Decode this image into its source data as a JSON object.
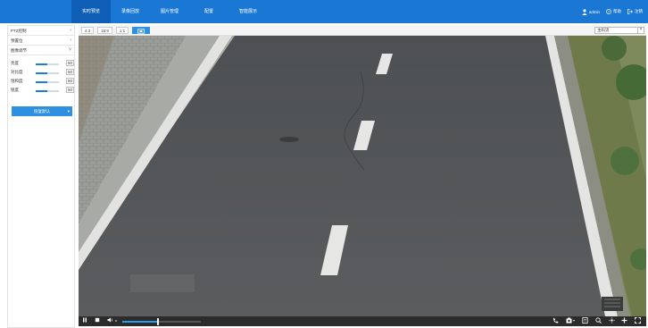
{
  "nav": {
    "items": [
      {
        "label": "实时预览",
        "active": true
      },
      {
        "label": "录像回放",
        "active": false
      },
      {
        "label": "图片管理",
        "active": false
      },
      {
        "label": "配置",
        "active": false
      },
      {
        "label": "智能展示",
        "active": false
      }
    ]
  },
  "header": {
    "user": "admin",
    "help": "帮助",
    "logout": "注销"
  },
  "sidebar": {
    "ptz": "PTZ控制",
    "preset": "预置位",
    "image_adjust": "图像调节",
    "adjustments": [
      {
        "label": "亮度",
        "value": "50",
        "level": 0.5
      },
      {
        "label": "对比度",
        "value": "50",
        "level": 0.5
      },
      {
        "label": "饱和度",
        "value": "50",
        "level": 0.5
      },
      {
        "label": "锐度",
        "value": "50",
        "level": 0.5
      }
    ],
    "restore_label": "恢复默认"
  },
  "toolbar": {
    "ratios": [
      "4:3",
      "16:9",
      "1:1"
    ],
    "stream_select": "主码流"
  },
  "volume": {
    "level": 0.45
  },
  "icons": {
    "pause": "pause-icon",
    "stop": "stop-icon",
    "volume": "volume-icon",
    "record": "record-icon",
    "snapshot": "camera-icon",
    "zoom": "zoom-icon",
    "ptz_toggle": "move-icon",
    "fullscreen": "fullscreen-icon"
  },
  "colors": {
    "brand": "#1a78d4",
    "accent": "#2e90e0"
  }
}
